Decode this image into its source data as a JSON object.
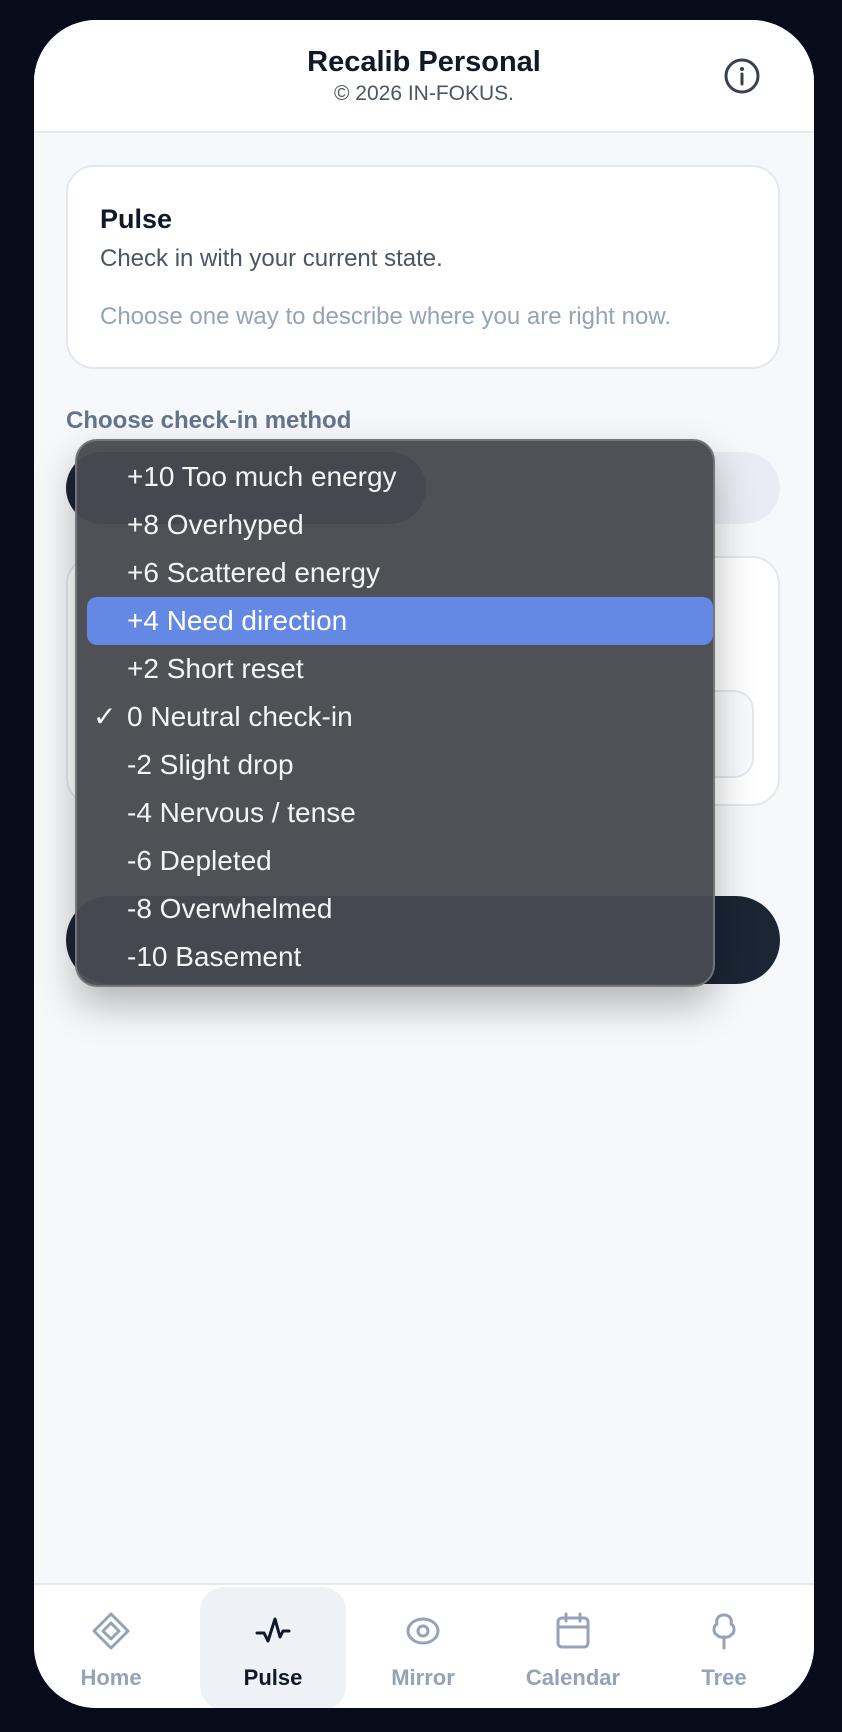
{
  "header": {
    "title": "Recalib Personal",
    "copyright": "© 2026 IN-FOKUS.",
    "info_icon": "info-circle-icon"
  },
  "pulse_card": {
    "title": "Pulse",
    "subtitle": "Check in with your current state.",
    "hint": "Choose one way to describe where you are right now."
  },
  "method": {
    "label": "Choose check-in method"
  },
  "dropdown": {
    "selected_value": "0 Neutral check-in",
    "highlighted_value": "+4 Need direction",
    "options": [
      {
        "label": "+10 Too much energy",
        "check": ""
      },
      {
        "label": "+8 Overhyped",
        "check": ""
      },
      {
        "label": "+6 Scattered energy",
        "check": ""
      },
      {
        "label": "+4 Need direction",
        "check": ""
      },
      {
        "label": "+2 Short reset",
        "check": ""
      },
      {
        "label": "0 Neutral check-in",
        "check": "✓"
      },
      {
        "label": "-2 Slight drop",
        "check": ""
      },
      {
        "label": "-4 Nervous / tense",
        "check": ""
      },
      {
        "label": "-6 Depleted",
        "check": ""
      },
      {
        "label": "-8 Overwhelmed",
        "check": ""
      },
      {
        "label": "-10 Basement",
        "check": ""
      }
    ]
  },
  "nav": {
    "active": "Pulse",
    "items": [
      {
        "label": "Home",
        "icon": "diamond-icon"
      },
      {
        "label": "Pulse",
        "icon": "pulse-icon"
      },
      {
        "label": "Mirror",
        "icon": "eye-icon"
      },
      {
        "label": "Calendar",
        "icon": "calendar-icon"
      },
      {
        "label": "Tree",
        "icon": "tree-icon"
      }
    ]
  },
  "colors": {
    "accent_highlight": "#6489e5",
    "dark_button": "#1c2534",
    "background": "#f6f8fb"
  }
}
